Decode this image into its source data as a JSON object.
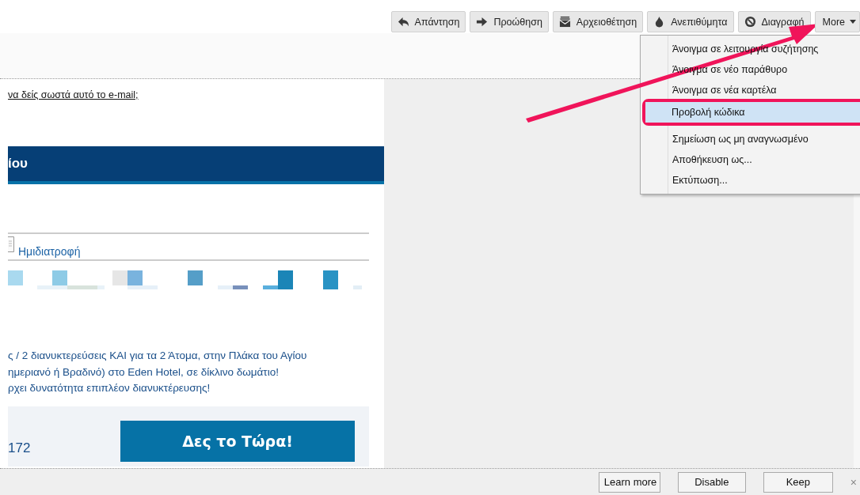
{
  "toolbar": {
    "buttons": [
      {
        "label": "Απάντηση"
      },
      {
        "label": "Προώθηση"
      },
      {
        "label": "Αρχειοθέτηση"
      },
      {
        "label": "Ανεπιθύμητα"
      },
      {
        "label": "Διαγραφή"
      }
    ],
    "more": {
      "label": "More"
    }
  },
  "more_menu": {
    "items": [
      {
        "label": "Άνοιγμα σε λειτουργία συζήτησης",
        "selected": false
      },
      {
        "label": "Άνοιγμα σε νέο παράθυρο",
        "selected": false
      },
      {
        "label": "Άνοιγμα σε νέα καρτέλα",
        "selected": false
      },
      {
        "label": "Προβολή κώδικα",
        "selected": true
      },
      {
        "label": "Σημείωση ως μη αναγνωσμένο",
        "selected": false
      },
      {
        "label": "Αποθήκευση ως...",
        "selected": false
      },
      {
        "label": "Εκτύπωση...",
        "selected": false
      }
    ]
  },
  "email": {
    "link": "να δείς σωστά αυτό το e-mail;",
    "banner": "ίου",
    "board_label": "Ημιδιατροφή",
    "description": [
      "ς / 2 διανυκτερεύσεις ΚΑΙ για τα 2 Άτομα, στην Πλάκα του Αγίου",
      "ημεριανό ή Βραδινό) στο Eden Hotel, σε δίκλινο δωμάτιο!",
      "ρχει δυνατότητα επιπλέον διανυκτέρευσης!"
    ],
    "price": "172",
    "cta": "Δες το Τώρα!"
  },
  "notification_bar": {
    "buttons": [
      "Learn more",
      "Disable",
      "Keep"
    ],
    "close": "×"
  }
}
